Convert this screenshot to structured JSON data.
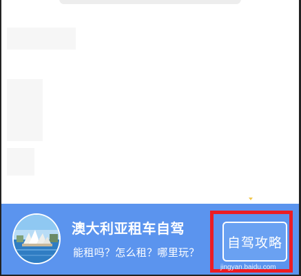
{
  "banner": {
    "title": "澳大利亚租车自驾",
    "subtitle": "能租吗？怎么租？哪里玩？",
    "cta_label": "自驾攻略",
    "background_color": "#5b94ee",
    "highlight_color": "#ec1c24"
  },
  "thumbnail": {
    "icon": "sydney-opera-house-photo"
  },
  "watermark": {
    "text": "jingyan.baidu.com"
  }
}
